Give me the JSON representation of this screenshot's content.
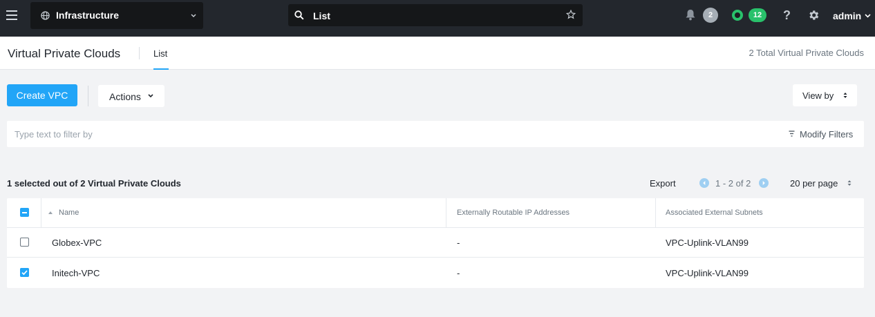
{
  "topbar": {
    "menu_icon": "hamburger-icon",
    "app_selector": {
      "icon": "globe-icon",
      "label": "Infrastructure"
    },
    "search": {
      "value": "List",
      "icon": "search-icon",
      "star_icon": "star-icon"
    },
    "alerts": {
      "icon": "bell-icon",
      "count": "2",
      "count_color": "#a6aeb6"
    },
    "health": {
      "status_color": "#29c16b",
      "count": "12"
    },
    "help_label": "?",
    "settings_icon": "gear-icon",
    "user": "admin"
  },
  "subheader": {
    "title": "Virtual Private Clouds",
    "tab_label": "List",
    "total_text": "2 Total Virtual Private Clouds"
  },
  "toolbar": {
    "create_label": "Create VPC",
    "actions_label": "Actions",
    "viewby_label": "View by"
  },
  "filter": {
    "placeholder": "Type text to filter by",
    "modify_label": "Modify Filters"
  },
  "summary": {
    "selected_text": "1 selected out of 2 Virtual Private Clouds",
    "export_label": "Export",
    "pagination_text": "1 - 2 of 2",
    "per_page_label": "20 per page"
  },
  "table": {
    "headers": [
      "Name",
      "Externally Routable IP Addresses",
      "Associated External Subnets"
    ],
    "rows": [
      {
        "checked": false,
        "name": "Globex-VPC",
        "ip": "-",
        "subnet": "VPC-Uplink-VLAN99"
      },
      {
        "checked": true,
        "name": "Initech-VPC",
        "ip": "-",
        "subnet": "VPC-Uplink-VLAN99"
      }
    ]
  },
  "colors": {
    "accent": "#22a5f7",
    "topbar": "#23272d",
    "success": "#29c16b"
  }
}
